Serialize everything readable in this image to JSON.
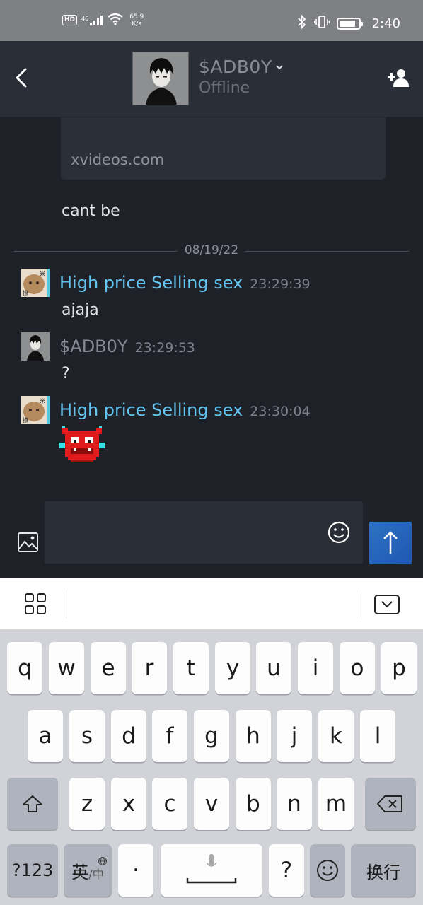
{
  "status_bar": {
    "hd": "HD",
    "signal_type": "46",
    "speed_value": "65.9",
    "speed_unit": "K/s",
    "time": "2:40",
    "icons": [
      "bluetooth-icon",
      "vibrate-icon",
      "battery-icon",
      "wifi-icon",
      "signal-icon"
    ]
  },
  "header": {
    "contact_name": "$ADB0Y",
    "status": "Offline",
    "caret": "˅",
    "back_icon": "back-chevron-icon",
    "add_friend_icon": "add-friend-icon"
  },
  "chat": {
    "link_preview": {
      "url": "xvideos.com"
    },
    "plain_message": "cant be",
    "date_divider": "08/19/22",
    "messages": [
      {
        "author": "High price Selling sex",
        "time": "23:29:39",
        "text": "ajaja",
        "author_color": "#62c4f0"
      },
      {
        "author": "$ADB0Y",
        "time": "23:29:53",
        "text": "?",
        "author_color": "#858992"
      },
      {
        "author": "High price Selling sex",
        "time": "23:30:04",
        "text": "",
        "emote": "red-devil-emoticon",
        "author_color": "#62c4f0"
      }
    ]
  },
  "composer": {
    "placeholder": "",
    "image_icon": "image-icon",
    "emoji_icon": "smiley-icon",
    "send_icon": "arrow-up-icon",
    "send_color": "#2664bb"
  },
  "keyboard": {
    "row1": [
      "q",
      "w",
      "e",
      "r",
      "t",
      "y",
      "u",
      "i",
      "o",
      "p"
    ],
    "row2": [
      "a",
      "s",
      "d",
      "f",
      "g",
      "h",
      "j",
      "k",
      "l"
    ],
    "row3": [
      "z",
      "x",
      "c",
      "v",
      "b",
      "n",
      "m"
    ],
    "bottom": {
      "num": "?123",
      "lang_main": "英",
      "lang_sub": "/中",
      "dot": "·",
      "question": "?",
      "enter": "换行"
    }
  }
}
